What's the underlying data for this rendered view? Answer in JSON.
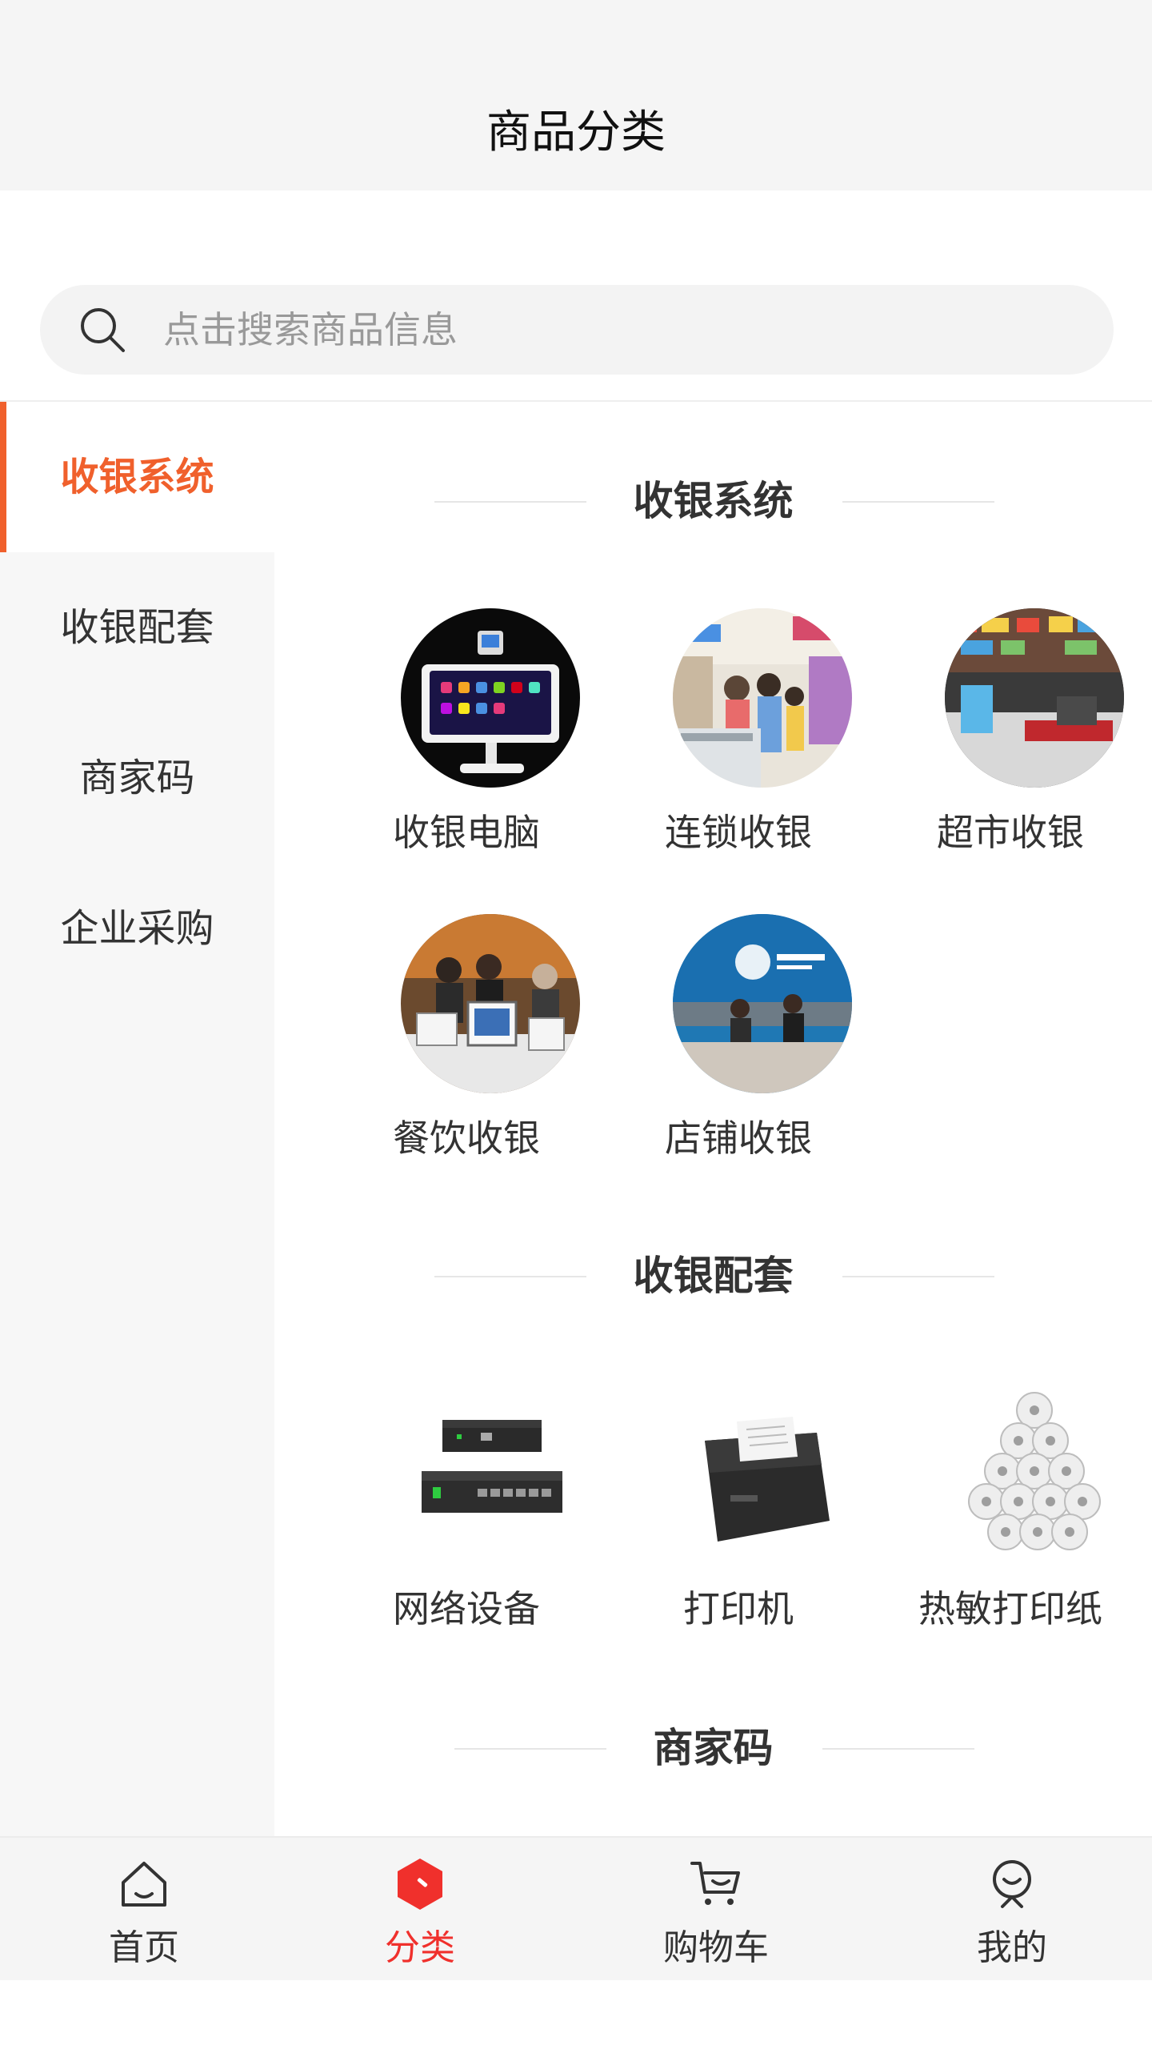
{
  "header": {
    "title": "商品分类"
  },
  "search": {
    "placeholder": "点击搜索商品信息"
  },
  "sidebar": {
    "items": [
      {
        "label": "收银系统",
        "active": true
      },
      {
        "label": "收银配套",
        "active": false
      },
      {
        "label": "商家码",
        "active": false
      },
      {
        "label": "企业采购",
        "active": false
      }
    ]
  },
  "sections": [
    {
      "title": "收银系统",
      "items": [
        {
          "label": "收银电脑",
          "image": "pos-terminal"
        },
        {
          "label": "连锁收银",
          "image": "chain-store-checkout"
        },
        {
          "label": "超市收银",
          "image": "supermarket-checkout"
        },
        {
          "label": "餐饮收银",
          "image": "restaurant-pos"
        },
        {
          "label": "店铺收银",
          "image": "shop-cashier-desk"
        }
      ]
    },
    {
      "title": "收银配套",
      "items": [
        {
          "label": "网络设备",
          "image": "network-switch"
        },
        {
          "label": "打印机",
          "image": "receipt-printer"
        },
        {
          "label": "热敏打印纸",
          "image": "thermal-paper-rolls"
        }
      ]
    },
    {
      "title": "商家码",
      "items": []
    }
  ],
  "tabbar": {
    "items": [
      {
        "label": "首页",
        "icon": "home-icon",
        "active": false
      },
      {
        "label": "分类",
        "icon": "category-icon",
        "active": true
      },
      {
        "label": "购物车",
        "icon": "cart-icon",
        "active": false
      },
      {
        "label": "我的",
        "icon": "profile-icon",
        "active": false
      }
    ]
  },
  "colors": {
    "accent": "#f0602c",
    "tab_active": "#f0302c",
    "sidebar_bg": "#f7f7f7"
  }
}
